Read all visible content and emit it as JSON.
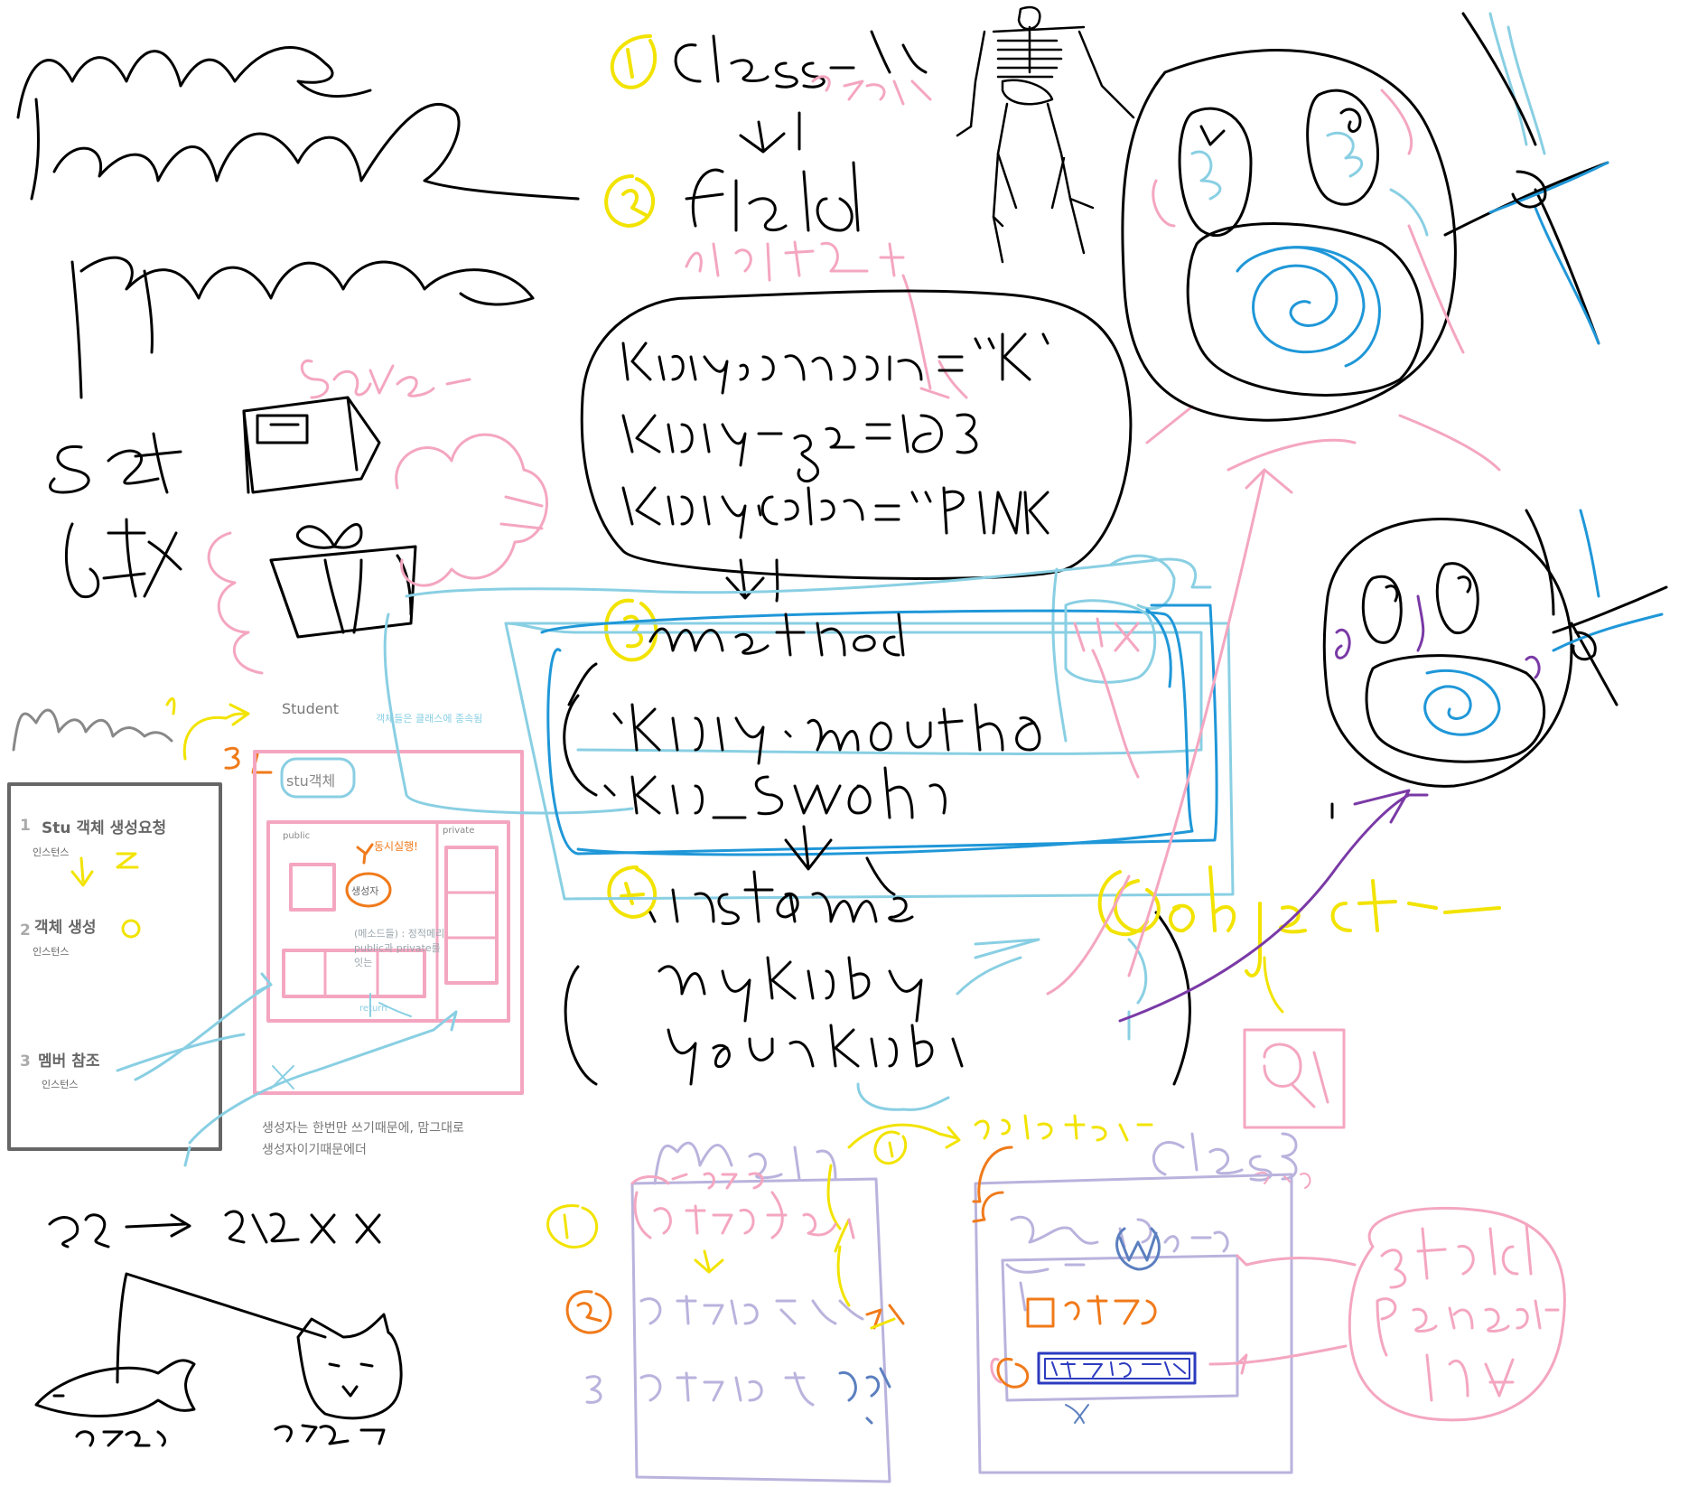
{
  "diagram": {
    "student_title": "Student",
    "inherit_note": "객체들은 클래스에 종속됨",
    "stu_object": "stu객체",
    "public_label": "public",
    "private_label": "private",
    "simultaneous": "동시실행!",
    "constructor": "생성자",
    "methods_note": "(메소드들) : 정적메리\npublic과 private를\n잇는",
    "return_label": "return",
    "instance_label": "인스턴스",
    "steps": [
      {
        "num": "1",
        "text": "Stu 객체 생성요청"
      },
      {
        "num": "2",
        "text": "객체 생성"
      },
      {
        "num": "3",
        "text": "멤버 참조"
      }
    ],
    "footer_note_line1": "생성자는 한번만 쓰기때문에, 맘그대로",
    "footer_note_line2": "생성자이기때문에더"
  },
  "colors": {
    "ink": "#000000",
    "pink": "#f4a6c0",
    "lightblue": "#89cfe3",
    "blue": "#1f97d8",
    "yellow": "#f2e300",
    "orange": "#f07a1a",
    "lavender": "#b9b3dd",
    "purple": "#7a3aa6",
    "gray": "#666666",
    "navy": "#2c3bbf"
  }
}
